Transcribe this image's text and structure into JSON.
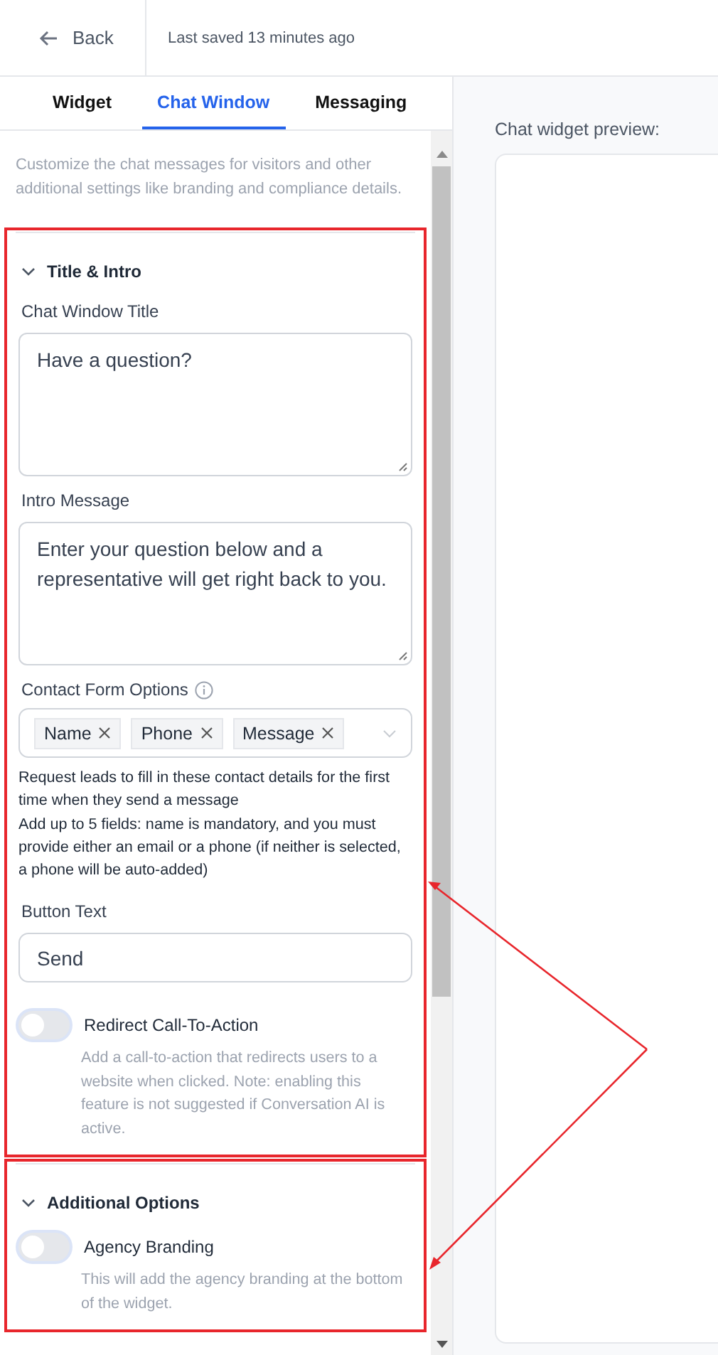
{
  "header": {
    "back_label": "Back",
    "status": "Last saved 13 minutes ago"
  },
  "tabs": [
    {
      "label": "Widget",
      "selected": false
    },
    {
      "label": "Chat Window",
      "selected": true
    },
    {
      "label": "Messaging",
      "selected": false
    }
  ],
  "description": "Customize the chat messages for visitors and other additional settings like branding and compliance details.",
  "sections": [
    {
      "title": "Title & Intro",
      "expanded": true,
      "highlighted": true,
      "items": [
        {
          "kind": "textarea",
          "label": "Chat Window Title",
          "value": "Have a question?"
        },
        {
          "kind": "textarea",
          "label": "Intro Message",
          "value": "Enter your question below and a representative will get right back to you."
        },
        {
          "kind": "tags",
          "label": "Contact Form Options",
          "tags": [
            "Name",
            "Phone",
            "Message"
          ],
          "help": [
            "Request leads to fill in these contact details for the first time when they send a message",
            "Add up to 5 fields: name is mandatory, and you must provide either an email or a phone (if neither is selected, a phone will be auto-added)"
          ]
        },
        {
          "kind": "input",
          "label": "Button Text",
          "value": "Send"
        },
        {
          "kind": "toggle",
          "label": "Redirect Call-To-Action",
          "on": false,
          "help": [
            "Add a call-to-action that redirects users to a website when clicked. Note: enabling this feature is not suggested if Conversation AI is active."
          ]
        }
      ]
    },
    {
      "title": "Additional Options",
      "expanded": true,
      "highlighted": true,
      "items": [
        {
          "kind": "toggle",
          "label": "Agency Branding",
          "on": false,
          "help": [
            "This will add the agency branding at the bottom of the widget."
          ]
        }
      ]
    }
  ],
  "preview": {
    "title": "Chat widget preview:"
  }
}
